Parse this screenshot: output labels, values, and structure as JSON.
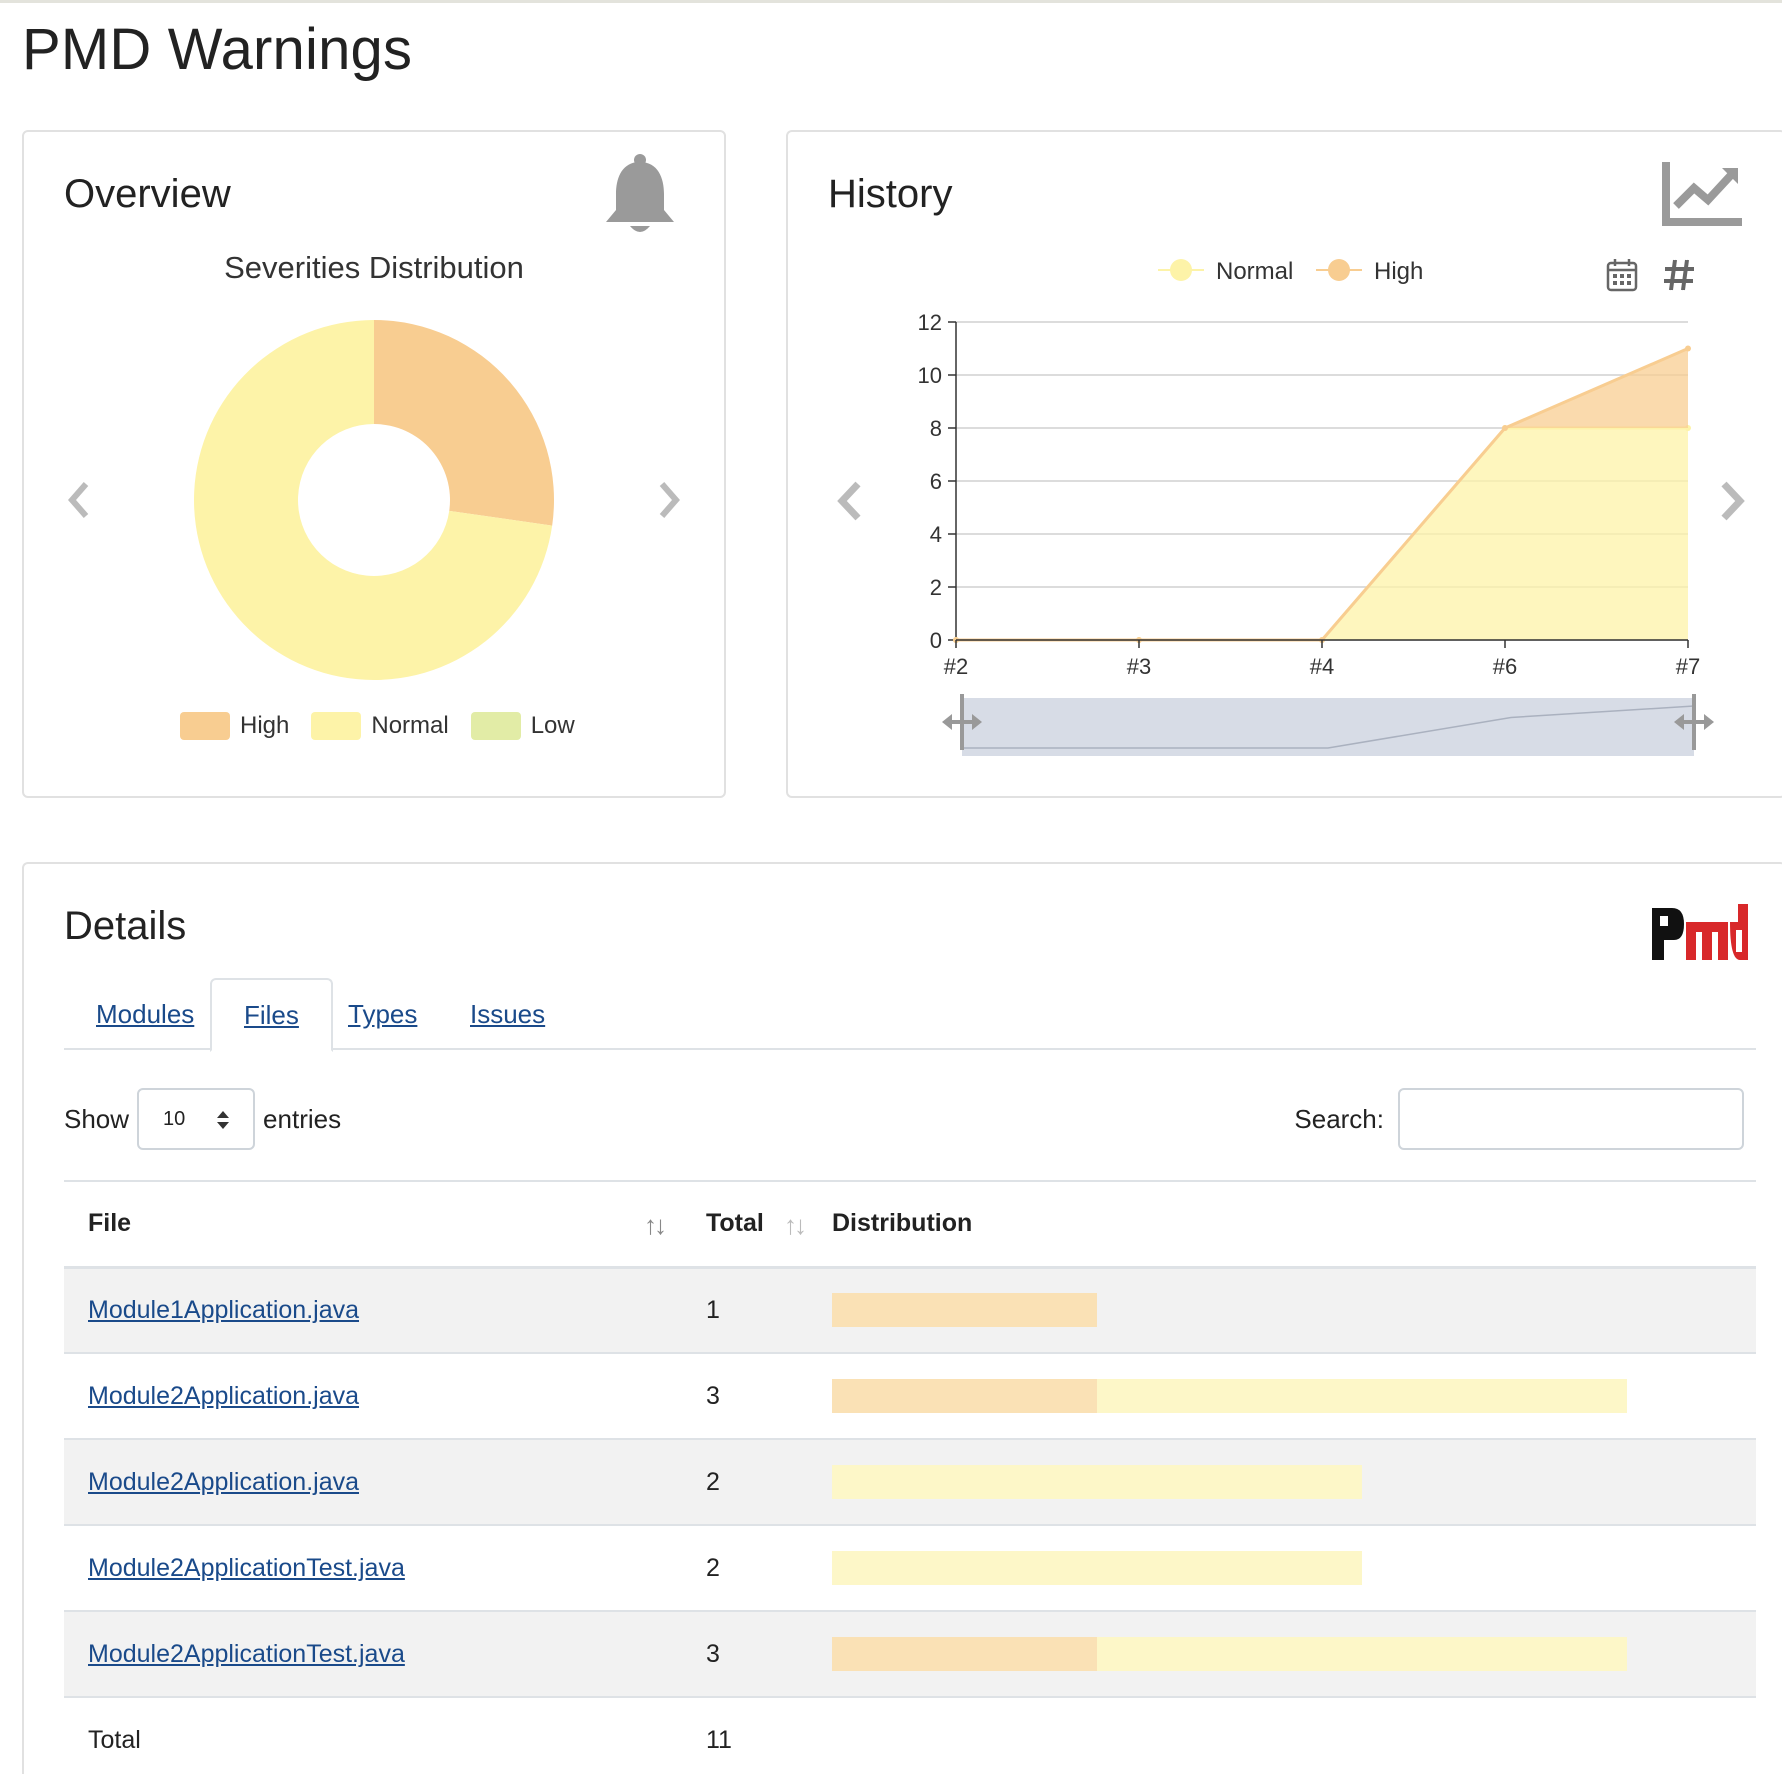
{
  "page": {
    "title": "PMD Warnings"
  },
  "colors": {
    "high": "#f8cd91",
    "normal": "#fdf3a8",
    "low": "#e2eca6",
    "link": "#1a4a8a",
    "bar_high": "#fae1b5",
    "bar_normal": "#fdf7c8"
  },
  "overview": {
    "title": "Overview",
    "icon": "bell-icon",
    "chart_title": "Severities Distribution",
    "legend": [
      {
        "label": "High",
        "color": "#f8cd91"
      },
      {
        "label": "Normal",
        "color": "#fdf3a8"
      },
      {
        "label": "Low",
        "color": "#e2eca6"
      }
    ]
  },
  "history": {
    "title": "History",
    "icon": "trend-chart-icon",
    "legend": [
      {
        "label": "Normal",
        "color": "#fdf3a8"
      },
      {
        "label": "High",
        "color": "#f8cd91"
      }
    ],
    "toolbar_icons": [
      "calendar-icon",
      "hash-icon"
    ]
  },
  "chart_data": [
    {
      "type": "pie",
      "title": "Severities Distribution",
      "categories": [
        "High",
        "Normal",
        "Low"
      ],
      "values": [
        3,
        8,
        0
      ],
      "colors": [
        "#f8cd91",
        "#fdf3a8",
        "#e2eca6"
      ],
      "donut": true,
      "legend": "bottom"
    },
    {
      "type": "area",
      "stacked": true,
      "categories": [
        "#2",
        "#3",
        "#4",
        "#6",
        "#7"
      ],
      "series": [
        {
          "name": "Normal",
          "values": [
            0,
            0,
            0,
            8,
            8
          ],
          "color": "#fdf3a8"
        },
        {
          "name": "High",
          "values": [
            0,
            0,
            0,
            0,
            3
          ],
          "color": "#f8cd91"
        }
      ],
      "ylim": [
        0,
        12
      ],
      "yticks": [
        0,
        2,
        4,
        6,
        8,
        10,
        12
      ],
      "grid": true,
      "legend": "top"
    }
  ],
  "details": {
    "title": "Details",
    "logo_text": "pmd",
    "tabs": [
      "Modules",
      "Files",
      "Types",
      "Issues"
    ],
    "active_tab": "Files",
    "show_label": "Show",
    "entries_label": "entries",
    "page_size": "10",
    "search_label": "Search:",
    "search_value": "",
    "columns": [
      "File",
      "Total",
      "Distribution"
    ],
    "rows": [
      {
        "file": "Module1Application.java",
        "total": "1",
        "high": 1,
        "normal": 0
      },
      {
        "file": "Module2Application.java",
        "total": "3",
        "high": 1,
        "normal": 2
      },
      {
        "file": "Module2Application.java",
        "total": "2",
        "high": 0,
        "normal": 2
      },
      {
        "file": "Module2ApplicationTest.java",
        "total": "2",
        "high": 0,
        "normal": 2
      },
      {
        "file": "Module2ApplicationTest.java",
        "total": "3",
        "high": 1,
        "normal": 2
      }
    ],
    "footer": {
      "label": "Total",
      "value": "11"
    }
  }
}
